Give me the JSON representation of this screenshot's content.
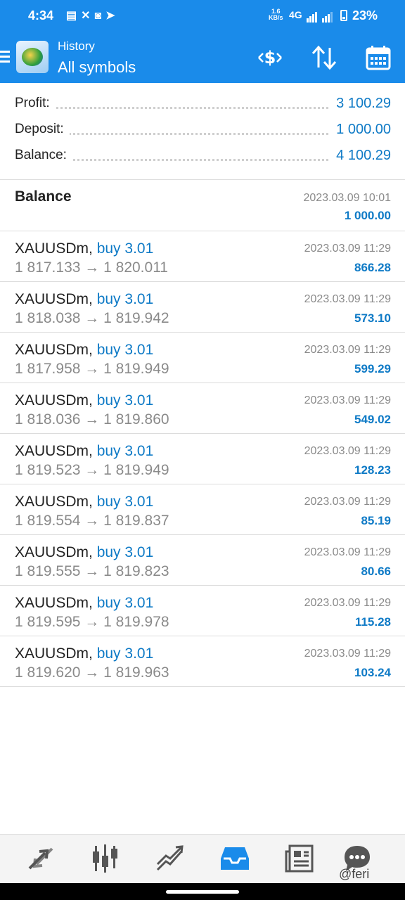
{
  "status_bar": {
    "time": "4:34",
    "notification_icons": [
      "message-icon",
      "missed-call-icon",
      "app-icon",
      "telegram-icon"
    ],
    "net_speed": "1.6",
    "net_speed_unit": "KB/s",
    "network": "4G",
    "battery": "23%"
  },
  "app_bar": {
    "subtitle": "History",
    "title": "All symbols",
    "actions": [
      "currency-filter-icon",
      "sort-icon",
      "calendar-icon"
    ]
  },
  "summary": {
    "profit_label": "Profit:",
    "profit_value": "3 100.29",
    "deposit_label": "Deposit:",
    "deposit_value": "1 000.00",
    "balance_label": "Balance:",
    "balance_value": "4 100.29"
  },
  "balance_entry": {
    "title": "Balance",
    "date": "2023.03.09 10:01",
    "amount": "1 000.00"
  },
  "trades": [
    {
      "symbol": "XAUUSDm,",
      "type": "buy 3.01",
      "open": "1 817.133",
      "close": "1 820.011",
      "date": "2023.03.09 11:29",
      "profit": "866.28"
    },
    {
      "symbol": "XAUUSDm,",
      "type": "buy 3.01",
      "open": "1 818.038",
      "close": "1 819.942",
      "date": "2023.03.09 11:29",
      "profit": "573.10"
    },
    {
      "symbol": "XAUUSDm,",
      "type": "buy 3.01",
      "open": "1 817.958",
      "close": "1 819.949",
      "date": "2023.03.09 11:29",
      "profit": "599.29"
    },
    {
      "symbol": "XAUUSDm,",
      "type": "buy 3.01",
      "open": "1 818.036",
      "close": "1 819.860",
      "date": "2023.03.09 11:29",
      "profit": "549.02"
    },
    {
      "symbol": "XAUUSDm,",
      "type": "buy 3.01",
      "open": "1 819.523",
      "close": "1 819.949",
      "date": "2023.03.09 11:29",
      "profit": "128.23"
    },
    {
      "symbol": "XAUUSDm,",
      "type": "buy 3.01",
      "open": "1 819.554",
      "close": "1 819.837",
      "date": "2023.03.09 11:29",
      "profit": "85.19"
    },
    {
      "symbol": "XAUUSDm,",
      "type": "buy 3.01",
      "open": "1 819.555",
      "close": "1 819.823",
      "date": "2023.03.09 11:29",
      "profit": "80.66"
    },
    {
      "symbol": "XAUUSDm,",
      "type": "buy 3.01",
      "open": "1 819.595",
      "close": "1 819.978",
      "date": "2023.03.09 11:29",
      "profit": "115.28"
    },
    {
      "symbol": "XAUUSDm,",
      "type": "buy 3.01",
      "open": "1 819.620",
      "close": "1 819.963",
      "date": "2023.03.09 11:29",
      "profit": "103.24"
    }
  ],
  "arrow": "→",
  "bottom_nav": {
    "items": [
      "quotes-icon",
      "chart-icon",
      "trade-icon",
      "history-icon",
      "news-icon",
      "chat-icon"
    ],
    "active": "history-icon"
  },
  "watermark": "@feri",
  "colors": {
    "brand_blue": "#1a8bea",
    "value_blue": "#0e7ac6",
    "muted_gray": "#8a8a8a"
  }
}
